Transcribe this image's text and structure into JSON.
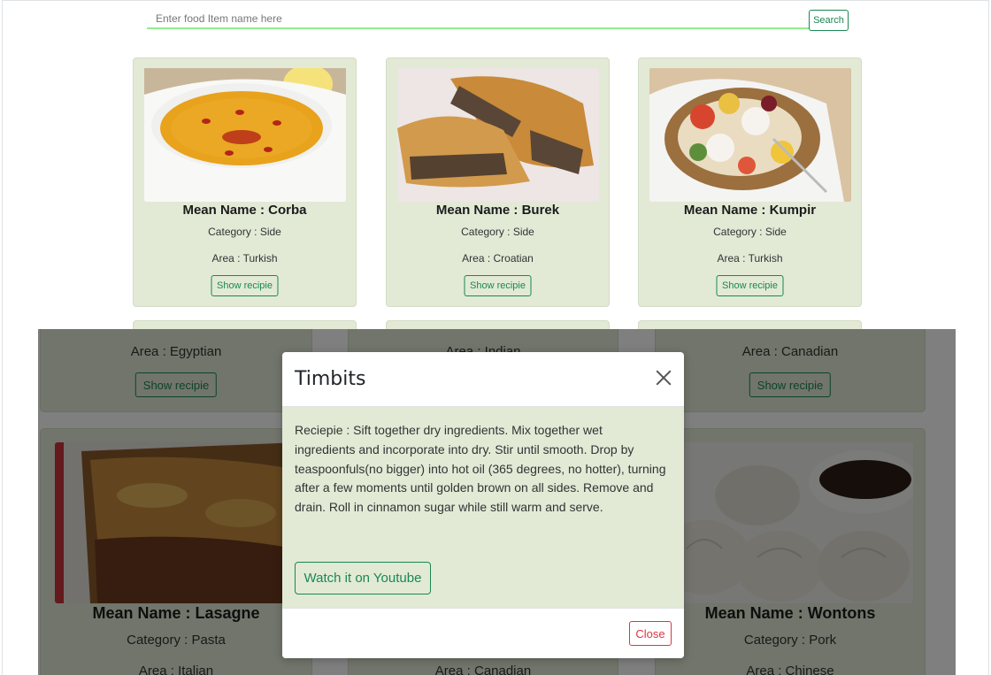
{
  "search": {
    "placeholder": "Enter food Item name here",
    "button_label": "Search"
  },
  "top_cards": [
    {
      "name": "Mean Name : Corba",
      "category": "Category : Side",
      "area": "Area : Turkish",
      "button": "Show recipie",
      "image": "corba-soup-photo"
    },
    {
      "name": "Mean Name : Burek",
      "category": "Category : Side",
      "area": "Area : Croatian",
      "button": "Show recipie",
      "image": "burek-pastry-photo"
    },
    {
      "name": "Mean Name : Kumpir",
      "category": "Category : Side",
      "area": "Area : Turkish",
      "button": "Show recipie",
      "image": "kumpir-potato-photo"
    }
  ],
  "bg_row1": [
    {
      "area": "Area : Egyptian",
      "button": "Show recipie"
    },
    {
      "area": "Area : Indian"
    },
    {
      "area": "Area : Canadian",
      "button": "Show recipie"
    }
  ],
  "bg_row2": [
    {
      "name": "Mean Name : Lasagne",
      "category": "Category : Pasta",
      "area": "Area : Italian",
      "image": "lasagne-photo"
    },
    {
      "area": "Area : Canadian"
    },
    {
      "name": "Mean Name : Wontons",
      "category": "Category : Pork",
      "area": "Area : Chinese",
      "image": "wontons-photo"
    }
  ],
  "modal": {
    "title": "Timbits",
    "recipe": "Reciepie : Sift together dry ingredients. Mix together wet ingredients and incorporate into dry. Stir until smooth. Drop by teaspoonfuls(no bigger) into hot oil (365 degrees, no hotter), turning after a few moments until golden brown on all sides. Remove and drain. Roll in cinnamon sugar while still warm and serve.",
    "youtube_button": "Watch it on Youtube",
    "close_button": "Close"
  },
  "colors": {
    "card_bg": "#e2ead6",
    "accent_green": "#198754",
    "search_underline": "#90ee90",
    "danger": "#dc3545"
  }
}
